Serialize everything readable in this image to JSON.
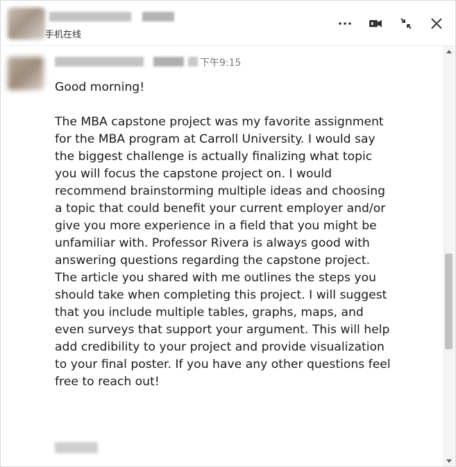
{
  "header": {
    "status": "手机在线",
    "icons": [
      "more-icon",
      "video-call-icon",
      "minimize-icon",
      "close-icon"
    ]
  },
  "message": {
    "time": "下午9:15",
    "greeting": "Good morning!",
    "body": "The MBA capstone project was my favorite assignment for the MBA program at Carroll University. I would say the biggest challenge is actually finalizing what topic you will focus the capstone project on. I would recommend brainstorming multiple ideas and choosing a topic that could benefit your current employer and/or give you more experience in a field that you might be unfamiliar with. Professor Rivera is always good with answering questions regarding the capstone project. The article you shared with me outlines the steps you should take when completing this project. I will suggest that you include multiple tables, graphs, maps, and even surveys that support your argument. This will help add credibility to your project and provide visualization to your final poster. If you have any other questions feel free to reach out!"
  }
}
